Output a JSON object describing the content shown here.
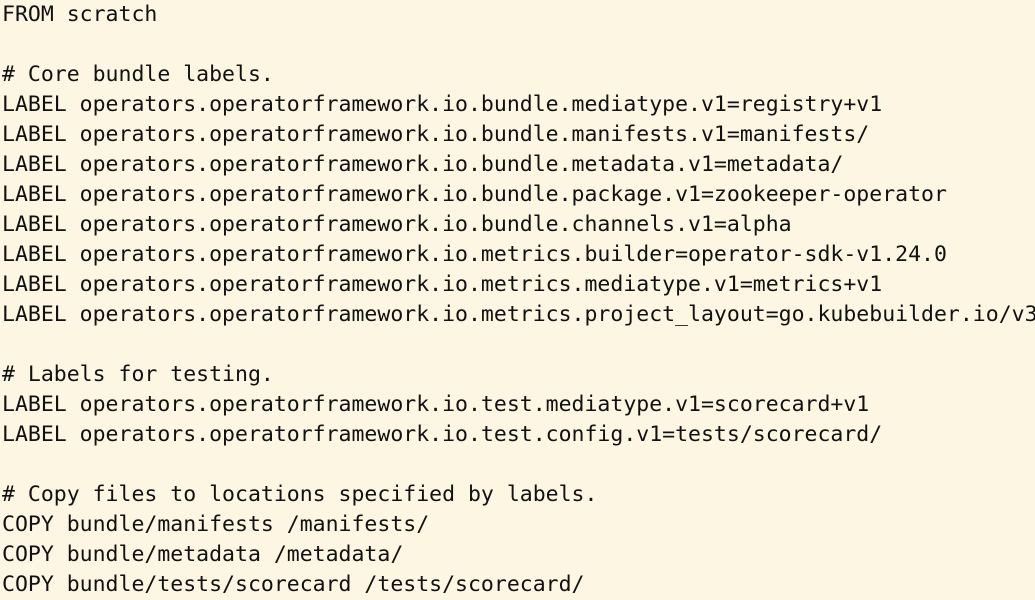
{
  "editor": {
    "background": "#fdf6e3",
    "text_color": "#111111",
    "lines": [
      "FROM scratch",
      "",
      "# Core bundle labels.",
      "LABEL operators.operatorframework.io.bundle.mediatype.v1=registry+v1",
      "LABEL operators.operatorframework.io.bundle.manifests.v1=manifests/",
      "LABEL operators.operatorframework.io.bundle.metadata.v1=metadata/",
      "LABEL operators.operatorframework.io.bundle.package.v1=zookeeper-operator",
      "LABEL operators.operatorframework.io.bundle.channels.v1=alpha",
      "LABEL operators.operatorframework.io.metrics.builder=operator-sdk-v1.24.0",
      "LABEL operators.operatorframework.io.metrics.mediatype.v1=metrics+v1",
      "LABEL operators.operatorframework.io.metrics.project_layout=go.kubebuilder.io/v3",
      "",
      "# Labels for testing.",
      "LABEL operators.operatorframework.io.test.mediatype.v1=scorecard+v1",
      "LABEL operators.operatorframework.io.test.config.v1=tests/scorecard/",
      "",
      "# Copy files to locations specified by labels.",
      "COPY bundle/manifests /manifests/",
      "COPY bundle/metadata /metadata/",
      "COPY bundle/tests/scorecard /tests/scorecard/"
    ]
  }
}
